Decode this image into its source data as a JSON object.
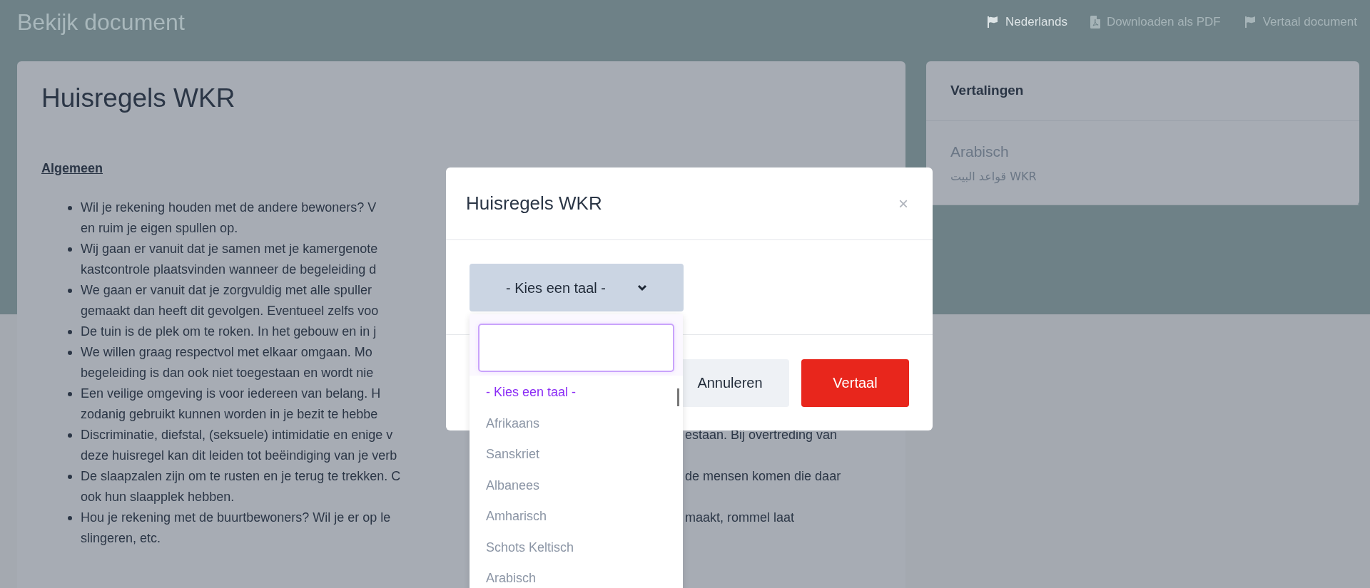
{
  "header": {
    "title": "Bekijk document",
    "actions": [
      {
        "label": "Nederlands",
        "kind": "language",
        "selected": true
      },
      {
        "label": "Downloaden als PDF",
        "kind": "download",
        "selected": false
      },
      {
        "label": "Vertaal document",
        "kind": "translate",
        "selected": false
      }
    ]
  },
  "document": {
    "title": "Huisregels WKR",
    "section_heading": "Algemeen",
    "bullets": [
      {
        "lines": [
          {
            "left": "Wil je rekening houden met de andere bewoners? V"
          },
          {
            "left": "en ruim je eigen spullen op."
          }
        ]
      },
      {
        "lines": [
          {
            "left": "Wij gaan er vanuit dat je samen met je kamergenote"
          },
          {
            "left": "kastcontrole plaatsvinden wanneer de begeleiding d"
          }
        ]
      },
      {
        "lines": [
          {
            "left": "We gaan er vanuit dat je zorgvuldig met alle spuller"
          },
          {
            "left": "gemaakt dan heeft dit gevolgen. Eventueel zelfs voo"
          }
        ]
      },
      {
        "lines": [
          {
            "left": "De tuin is de plek om te roken. In het gebouw en in j"
          }
        ]
      },
      {
        "lines": [
          {
            "left": "We willen graag respectvol met elkaar omgaan. Mo"
          },
          {
            "left": "begeleiding is dan ook niet toegestaan en wordt nie"
          }
        ]
      },
      {
        "lines": [
          {
            "left": "Een veilige omgeving is voor iedereen van belang. H"
          },
          {
            "left": "zodanig gebruikt kunnen worden in je bezit te hebbe"
          }
        ]
      },
      {
        "lines": [
          {
            "left": "Discriminatie, diefstal, (seksuele) intimidatie en enige v",
            "right": "estaan. Bij overtreding van"
          },
          {
            "left": "deze huisregel kan dit leiden tot beëindiging van je verb"
          }
        ]
      },
      {
        "lines": [
          {
            "left": "De slaapzalen zijn om te rusten en je terug te trekken. C",
            "right": "de mensen komen die daar"
          },
          {
            "left": "ook hun slaapplek hebben."
          }
        ]
      },
      {
        "lines": [
          {
            "left": "Hou je rekening met de buurtbewoners? Wil je er op le",
            "right": "maakt, rommel laat"
          },
          {
            "left": "slingeren, etc."
          }
        ]
      }
    ]
  },
  "translations": {
    "title": "Vertalingen",
    "items": [
      {
        "language": "Arabisch",
        "title": "قواعد البيت WKR"
      }
    ]
  },
  "modal": {
    "title": "Huisregels WKR",
    "close": "×",
    "select": {
      "value": "- Kies een taal -"
    },
    "options": [
      {
        "label": "- Kies een taal -",
        "selected": true
      },
      {
        "label": "Afrikaans",
        "selected": false
      },
      {
        "label": "Sanskriet",
        "selected": false
      },
      {
        "label": "Albanees",
        "selected": false
      },
      {
        "label": "Amharisch",
        "selected": false
      },
      {
        "label": "Schots Keltisch",
        "selected": false
      },
      {
        "label": "Arabisch",
        "selected": false
      }
    ],
    "buttons": [
      {
        "label": "Annuleren",
        "kind": "secondary"
      },
      {
        "label": "Vertaal",
        "kind": "primary"
      }
    ]
  }
}
